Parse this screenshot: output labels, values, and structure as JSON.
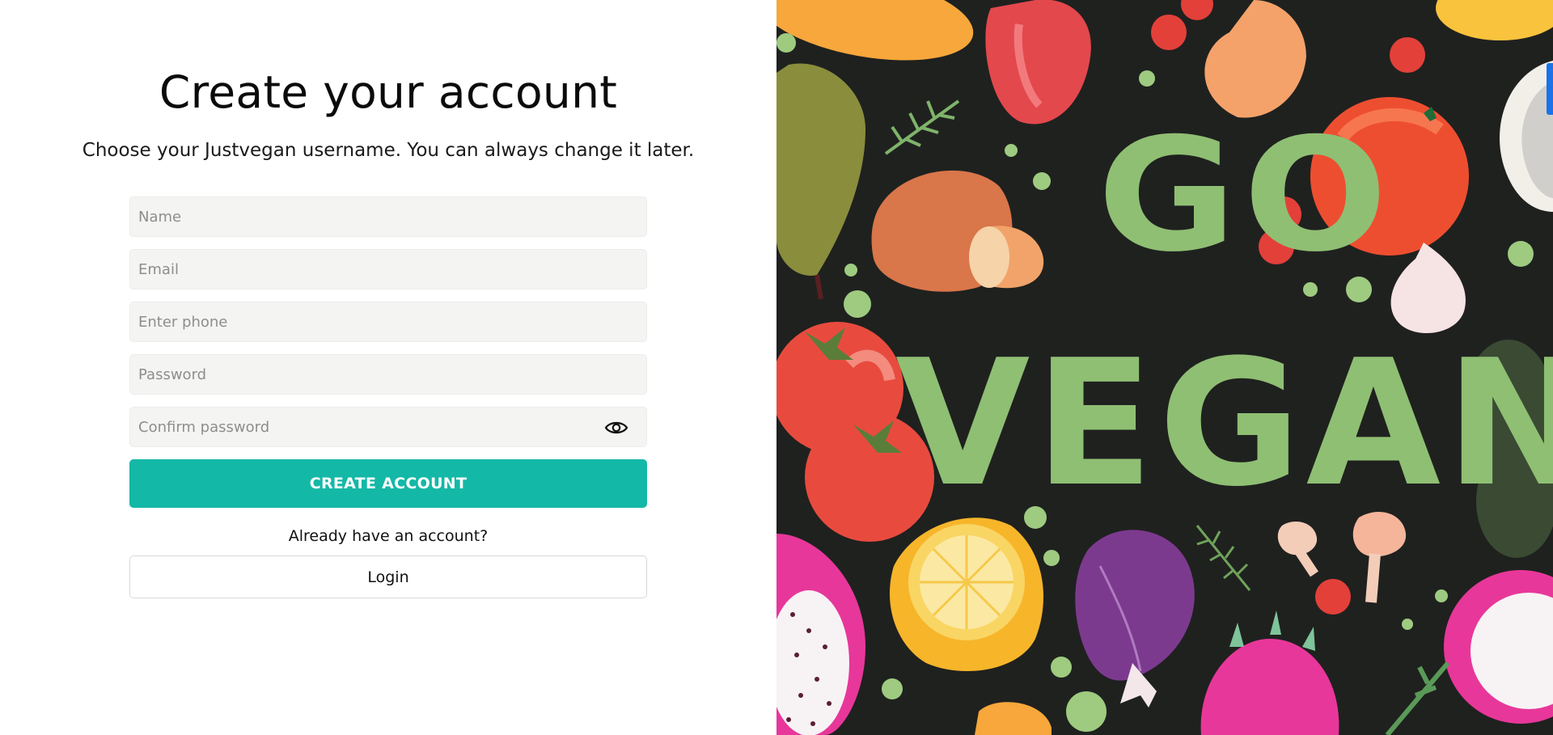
{
  "form": {
    "title": "Create your account",
    "subtitle": "Choose your Justvegan username. You can always change it later.",
    "fields": {
      "name_placeholder": "Name",
      "email_placeholder": "Email",
      "phone_placeholder": "Enter phone",
      "password_placeholder": "Password",
      "confirm_password_placeholder": "Confirm password"
    },
    "create_button_label": "CREATE ACCOUNT",
    "login_prompt": "Already have an account?",
    "login_button_label": "Login"
  },
  "artwork": {
    "headline_line1": "GO",
    "headline_line2": "VEGAN"
  },
  "colors": {
    "accent": "#14b8a6",
    "artwork_background": "#1f211f",
    "artwork_text": "#8fbf73"
  },
  "icons": {
    "password_toggle": "eye-icon"
  }
}
